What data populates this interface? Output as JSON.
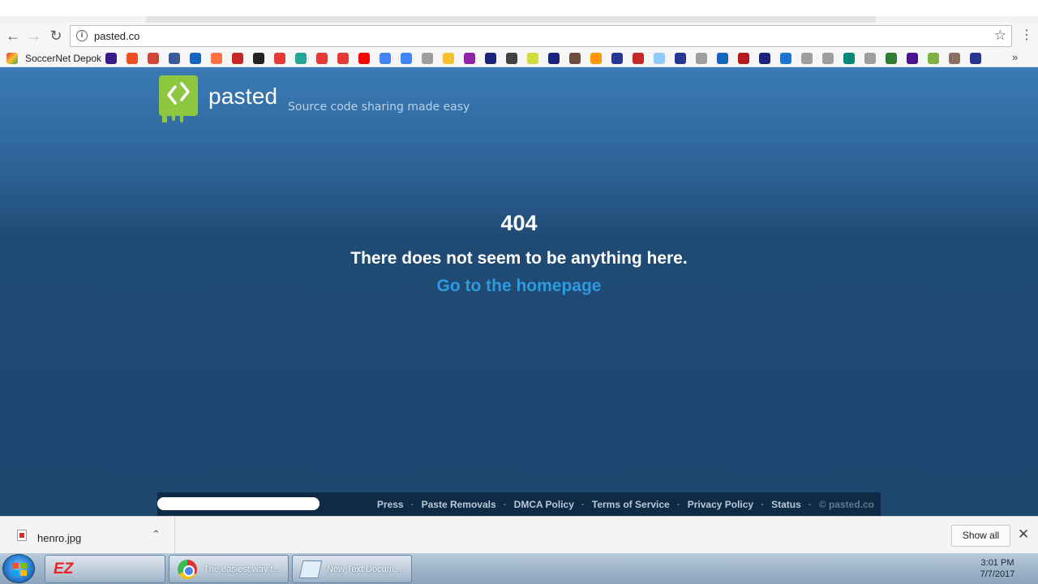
{
  "browser": {
    "url": "pasted.co",
    "bookmarks": {
      "first_label": "SoccerNet Depok",
      "icon_colors": [
        "#3b1a8c",
        "#f25022",
        "#d44638",
        "#3b5998",
        "#1565c0",
        "#ff7043",
        "#c62828",
        "#222222",
        "#e53935",
        "#26a69a",
        "#e53935",
        "#e53935",
        "#ff0000",
        "#4285f4",
        "#4285f4",
        "#9e9e9e",
        "#fbc02d",
        "#8e24aa",
        "#1a237e",
        "#424242",
        "#cddc39",
        "#1a237e",
        "#6d4c41",
        "#ff9800",
        "#283593",
        "#c62828",
        "#90caf9",
        "#283593",
        "#9e9e9e",
        "#1565c0",
        "#b71c1c",
        "#1a237e",
        "#1976d2",
        "#9e9e9e",
        "#9e9e9e",
        "#00897b",
        "#9e9e9e",
        "#2e7d32",
        "#4a148c",
        "#7cb342",
        "#8d6e63",
        "#283593"
      ]
    }
  },
  "site": {
    "brand": "pasted",
    "tagline": "Source code sharing made easy",
    "error_code": "404",
    "error_message": "There does not seem to be anything here.",
    "home_link": "Go to the homepage",
    "accent_color": "#2d9ae0",
    "logo_color": "#8dc63f"
  },
  "footer": {
    "links": [
      "Press",
      "Paste Removals",
      "DMCA Policy",
      "Terms of Service",
      "Privacy Policy",
      "Status"
    ],
    "copyright": "© pasted.co"
  },
  "downloads": {
    "file_name": "henro.jpg",
    "show_all": "Show all"
  },
  "taskbar": {
    "app1_label": "EZ",
    "app2_label": "The easiest way t...",
    "app3_label": "New Text Docum...",
    "time": "3:01 PM",
    "date": "7/7/2017"
  }
}
